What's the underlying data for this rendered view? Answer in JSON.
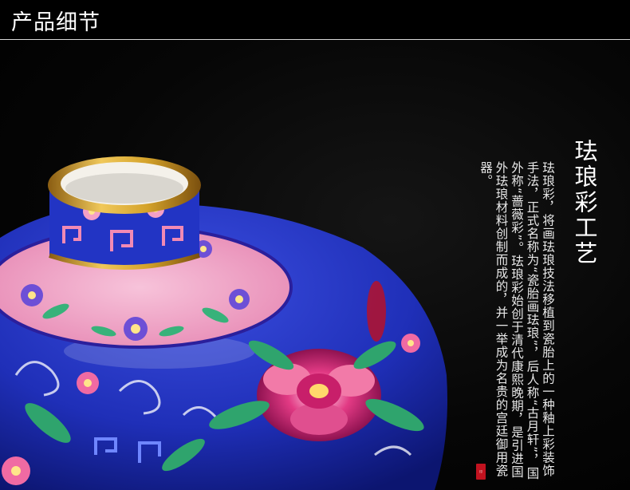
{
  "header": {
    "title": "产品细节"
  },
  "article": {
    "title": "珐琅彩工艺",
    "body": "珐琅彩，将画珐琅技法移植到瓷胎上的一种釉上彩装饰手法，正式名称为“瓷胎画珐琅”，后人称“古月轩”，国外称“蔷薇彩”。珐琅彩始创于清代康熙晚期，是引进国外珐琅材料创制而成的，并一举成为名贵的宫廷御用瓷器。"
  },
  "colors": {
    "background": "#000000",
    "cobalt": "#1f2fb8",
    "pink": "#f2a6c8",
    "gold": "#d4a22a",
    "seal_red": "#c1121f"
  }
}
